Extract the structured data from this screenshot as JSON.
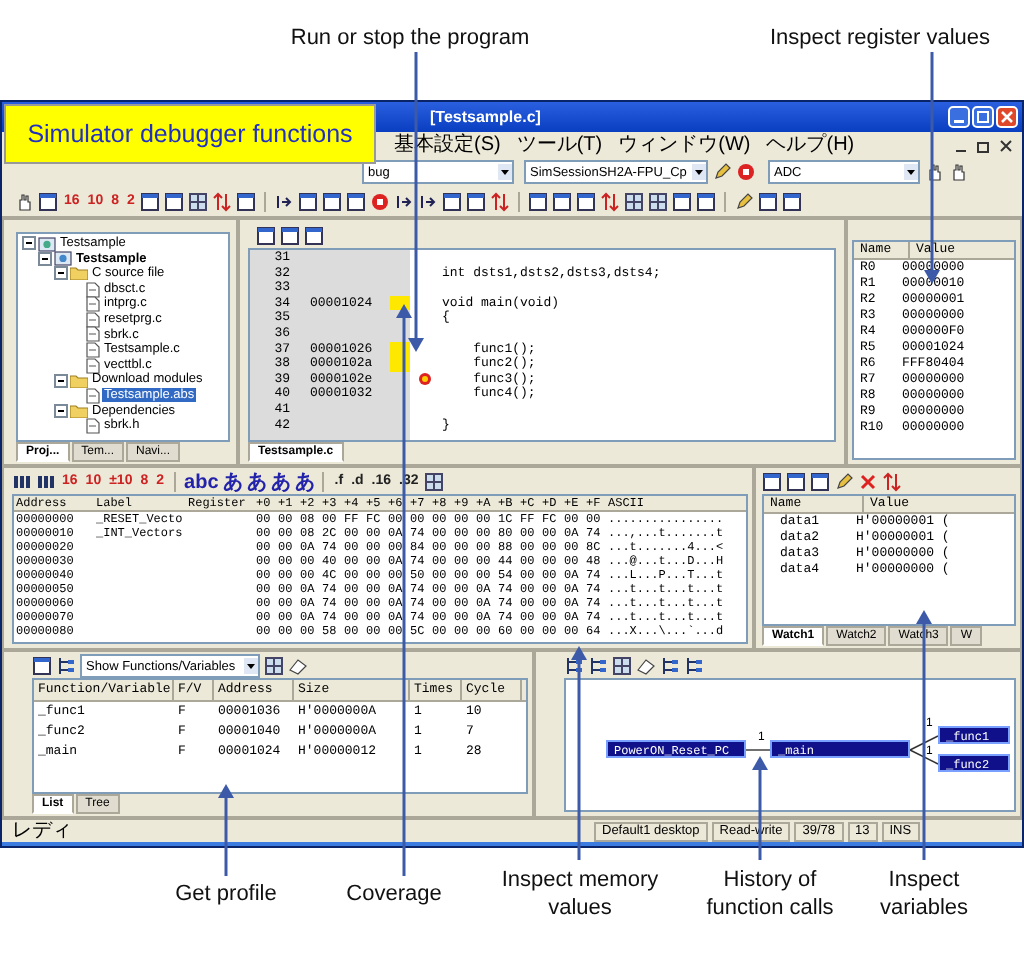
{
  "banner": "Simulator debugger functions",
  "callouts": [
    {
      "text": "Run or stop the program"
    },
    {
      "text": "Inspect register values"
    },
    {
      "text": "Get profile"
    },
    {
      "text": "Coverage"
    },
    {
      "text": "Inspect memory values"
    },
    {
      "text": "History of function calls"
    },
    {
      "text": "Inspect variables"
    }
  ],
  "window": {
    "title": "[Testsample.c]",
    "menu": [
      "基本設定(S)",
      "ツール(T)",
      "ウィンドウ(W)",
      "ヘルプ(H)"
    ],
    "combos": [
      "bug",
      "SimSessionSH2A-FPU_Cp",
      "ADC"
    ],
    "radix_buttons": [
      "16",
      "10",
      "8",
      "2"
    ]
  },
  "project_tree": {
    "items": [
      {
        "label": "Testsample",
        "kind": "workspace",
        "expanded": true,
        "selected": false,
        "children": [
          {
            "label": "Testsample",
            "kind": "project",
            "expanded": true,
            "selected": false,
            "children": [
              {
                "label": "C source file",
                "kind": "folder",
                "expanded": true,
                "selected": false,
                "children": [
                  {
                    "label": "dbsct.c",
                    "kind": "file",
                    "selected": false
                  },
                  {
                    "label": "intprg.c",
                    "kind": "file",
                    "selected": false
                  },
                  {
                    "label": "resetprg.c",
                    "kind": "file",
                    "selected": false
                  },
                  {
                    "label": "sbrk.c",
                    "kind": "file",
                    "selected": false
                  },
                  {
                    "label": "Testsample.c",
                    "kind": "file",
                    "selected": false
                  },
                  {
                    "label": "vecttbl.c",
                    "kind": "file",
                    "selected": false
                  }
                ]
              },
              {
                "label": "Download modules",
                "kind": "folder",
                "expanded": true,
                "selected": false,
                "children": [
                  {
                    "label": "Testsample.abs",
                    "kind": "file",
                    "selected": true
                  }
                ]
              },
              {
                "label": "Dependencies",
                "kind": "folder",
                "expanded": true,
                "selected": false,
                "children": [
                  {
                    "label": "sbrk.h",
                    "kind": "file",
                    "selected": false
                  }
                ]
              }
            ]
          }
        ]
      }
    ],
    "tabs": [
      {
        "label": "Proj...",
        "selected": true
      },
      {
        "label": "Tem...",
        "selected": false
      },
      {
        "label": "Navi...",
        "selected": false
      }
    ]
  },
  "editor": {
    "lines": [
      {
        "no": "31",
        "covered": false,
        "pc": false
      },
      {
        "no": "32",
        "covered": false,
        "pc": false,
        "code": "int dsts1,dsts2,dsts3,dsts4;"
      },
      {
        "no": "33",
        "covered": false,
        "pc": false
      },
      {
        "no": "34",
        "address": "00001024",
        "covered": true,
        "pc": false,
        "code": "void main(void)"
      },
      {
        "no": "35",
        "covered": false,
        "pc": false,
        "code": "{"
      },
      {
        "no": "36",
        "covered": false,
        "pc": false
      },
      {
        "no": "37",
        "address": "00001026",
        "covered": true,
        "pc": false,
        "code": "    func1();"
      },
      {
        "no": "38",
        "address": "0000102a",
        "covered": true,
        "pc": false,
        "code": "    func2();"
      },
      {
        "no": "39",
        "address": "0000102e",
        "covered": false,
        "pc": true,
        "code": "    func3();"
      },
      {
        "no": "40",
        "address": "00001032",
        "covered": false,
        "pc": false,
        "code": "    func4();"
      },
      {
        "no": "41",
        "covered": false,
        "pc": false
      },
      {
        "no": "42",
        "covered": false,
        "pc": false,
        "code": "}"
      }
    ],
    "tabs": [
      {
        "label": "Testsample.c",
        "selected": true
      }
    ]
  },
  "registers": {
    "columns": [
      "Name",
      "Value"
    ],
    "rows": [
      {
        "name": "R0",
        "value": "00000000"
      },
      {
        "name": "R1",
        "value": "00000010"
      },
      {
        "name": "R2",
        "value": "00000001"
      },
      {
        "name": "R3",
        "value": "00000000"
      },
      {
        "name": "R4",
        "value": "000000F0"
      },
      {
        "name": "R5",
        "value": "00001024"
      },
      {
        "name": "R6",
        "value": "FFF80404"
      },
      {
        "name": "R7",
        "value": "00000000"
      },
      {
        "name": "R8",
        "value": "00000000"
      },
      {
        "name": "R9",
        "value": "00000000"
      },
      {
        "name": "R10",
        "value": "00000000"
      }
    ]
  },
  "memory": {
    "radix_buttons": [
      "16",
      "10",
      "±10",
      "8",
      "2"
    ],
    "char_buttons": [
      "abc",
      "あ",
      "あ",
      "あ",
      "あ"
    ],
    "format_buttons": [
      ".f",
      ".d",
      ".16",
      ".32"
    ],
    "columns": [
      "Address",
      "Label",
      "Register",
      "+0",
      "+1",
      "+2",
      "+3",
      "+4",
      "+5",
      "+6",
      "+7",
      "+8",
      "+9",
      "+A",
      "+B",
      "+C",
      "+D",
      "+E",
      "+F",
      "ASCII"
    ],
    "rows": [
      {
        "address": "00000000",
        "label": "_RESET_Vecto",
        "bytes": [
          "00",
          "00",
          "08",
          "00",
          "FF",
          "FC",
          "00",
          "00",
          "00",
          "00",
          "00",
          "1C",
          "FF",
          "FC",
          "00",
          "00"
        ],
        "ascii": "................"
      },
      {
        "address": "00000010",
        "label": "_INT_Vectors",
        "bytes": [
          "00",
          "00",
          "08",
          "2C",
          "00",
          "00",
          "0A",
          "74",
          "00",
          "00",
          "00",
          "80",
          "00",
          "00",
          "0A",
          "74"
        ],
        "ascii": "...,...t.......t"
      },
      {
        "address": "00000020",
        "bytes": [
          "00",
          "00",
          "0A",
          "74",
          "00",
          "00",
          "00",
          "84",
          "00",
          "00",
          "00",
          "88",
          "00",
          "00",
          "00",
          "8C"
        ],
        "ascii": "...t.......4...<"
      },
      {
        "address": "00000030",
        "bytes": [
          "00",
          "00",
          "00",
          "40",
          "00",
          "00",
          "0A",
          "74",
          "00",
          "00",
          "00",
          "44",
          "00",
          "00",
          "00",
          "48"
        ],
        "ascii": "...@...t...D...H"
      },
      {
        "address": "00000040",
        "bytes": [
          "00",
          "00",
          "00",
          "4C",
          "00",
          "00",
          "00",
          "50",
          "00",
          "00",
          "00",
          "54",
          "00",
          "00",
          "0A",
          "74"
        ],
        "ascii": "...L...P...T...t"
      },
      {
        "address": "00000050",
        "bytes": [
          "00",
          "00",
          "0A",
          "74",
          "00",
          "00",
          "0A",
          "74",
          "00",
          "00",
          "0A",
          "74",
          "00",
          "00",
          "0A",
          "74"
        ],
        "ascii": "...t...t...t...t"
      },
      {
        "address": "00000060",
        "bytes": [
          "00",
          "00",
          "0A",
          "74",
          "00",
          "00",
          "0A",
          "74",
          "00",
          "00",
          "0A",
          "74",
          "00",
          "00",
          "0A",
          "74"
        ],
        "ascii": "...t...t...t...t"
      },
      {
        "address": "00000070",
        "bytes": [
          "00",
          "00",
          "0A",
          "74",
          "00",
          "00",
          "0A",
          "74",
          "00",
          "00",
          "0A",
          "74",
          "00",
          "00",
          "0A",
          "74"
        ],
        "ascii": "...t...t...t...t"
      },
      {
        "address": "00000080",
        "bytes": [
          "00",
          "00",
          "00",
          "58",
          "00",
          "00",
          "00",
          "5C",
          "00",
          "00",
          "00",
          "60",
          "00",
          "00",
          "00",
          "64"
        ],
        "ascii": "...X...\\...`...d"
      }
    ]
  },
  "watch": {
    "columns": [
      "Name",
      "Value"
    ],
    "rows": [
      {
        "name": "data1",
        "value": "H'00000001 ("
      },
      {
        "name": "data2",
        "value": "H'00000001 ("
      },
      {
        "name": "data3",
        "value": "H'00000000 ("
      },
      {
        "name": "data4",
        "value": "H'00000000 ("
      }
    ],
    "tabs": [
      {
        "label": "Watch1",
        "selected": true
      },
      {
        "label": "Watch2",
        "selected": false
      },
      {
        "label": "Watch3",
        "selected": false
      },
      {
        "label": "W",
        "selected": false
      }
    ]
  },
  "profile": {
    "filter": "Show Functions/Variables",
    "columns": [
      "Function/Variable",
      "F/V",
      "Address",
      "Size",
      "Times",
      "Cycle"
    ],
    "rows": [
      {
        "cells": [
          "_func1",
          "F",
          "00001036",
          "H'0000000A",
          "1",
          "10"
        ]
      },
      {
        "cells": [
          "_func2",
          "F",
          "00001040",
          "H'0000000A",
          "1",
          "7"
        ]
      },
      {
        "cells": [
          "_main",
          "F",
          "00001024",
          "H'00000012",
          "1",
          "28"
        ]
      }
    ],
    "tabs": [
      {
        "label": "List",
        "selected": true
      },
      {
        "label": "Tree",
        "selected": false
      }
    ]
  },
  "call_history": {
    "nodes": [
      {
        "label": "PowerON_Reset_PC"
      },
      {
        "label": "_main"
      },
      {
        "label": "_func1"
      },
      {
        "label": "_func2"
      }
    ],
    "edges": [
      {
        "label": "1"
      },
      {
        "label": "1"
      },
      {
        "label": "1"
      }
    ]
  },
  "status_bar": [
    "レディ",
    "Default1 desktop",
    "Read-write",
    "39/78",
    "13",
    "INS"
  ]
}
